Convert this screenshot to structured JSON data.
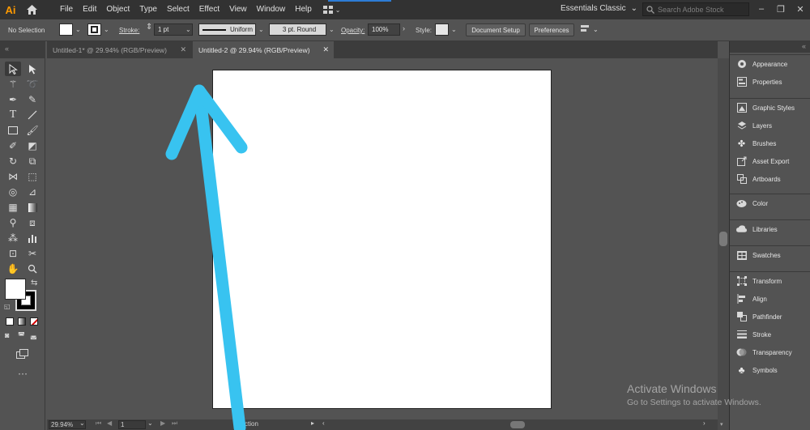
{
  "app": {
    "logo": "Ai",
    "accent": "#ff9a00"
  },
  "menu": [
    "File",
    "Edit",
    "Object",
    "Type",
    "Select",
    "Effect",
    "View",
    "Window",
    "Help"
  ],
  "workspace": {
    "label": "Essentials Classic"
  },
  "search": {
    "placeholder": "Search Adobe Stock"
  },
  "window_controls": {
    "minimize": "–",
    "maximize": "❐",
    "close": "✕"
  },
  "control": {
    "selection": "No Selection",
    "stroke_label": "Stroke:",
    "stroke_value": "1 pt",
    "profile": "Uniform",
    "brush": "3 pt. Round",
    "opacity_label": "Opacity:",
    "opacity_value": "100%",
    "style_label": "Style:",
    "doc_setup": "Document Setup",
    "preferences": "Preferences"
  },
  "tabs": [
    {
      "label": "Untitled-1* @ 29.94% (RGB/Preview)",
      "active": false
    },
    {
      "label": "Untitled-2 @ 29.94% (RGB/Preview)",
      "active": true
    }
  ],
  "status": {
    "zoom": "29.94%",
    "artboard": "1",
    "tool_hint": "ction"
  },
  "panels": [
    {
      "items": [
        {
          "label": "Appearance",
          "icon": "appearance-icon"
        },
        {
          "label": "Properties",
          "icon": "properties-icon"
        }
      ]
    },
    {
      "items": [
        {
          "label": "Graphic Styles",
          "icon": "graphic-styles-icon"
        },
        {
          "label": "Layers",
          "icon": "layers-icon"
        },
        {
          "label": "Brushes",
          "icon": "brushes-icon"
        },
        {
          "label": "Asset Export",
          "icon": "asset-export-icon"
        },
        {
          "label": "Artboards",
          "icon": "artboards-icon"
        }
      ]
    },
    {
      "items": [
        {
          "label": "Color",
          "icon": "color-icon"
        }
      ]
    },
    {
      "items": [
        {
          "label": "Libraries",
          "icon": "libraries-icon"
        }
      ]
    },
    {
      "items": [
        {
          "label": "Swatches",
          "icon": "swatches-icon"
        }
      ]
    },
    {
      "items": [
        {
          "label": "Transform",
          "icon": "transform-icon"
        },
        {
          "label": "Align",
          "icon": "align-icon"
        },
        {
          "label": "Pathfinder",
          "icon": "pathfinder-icon"
        },
        {
          "label": "Stroke",
          "icon": "stroke-icon"
        },
        {
          "label": "Transparency",
          "icon": "transparency-icon"
        },
        {
          "label": "Symbols",
          "icon": "symbols-icon"
        }
      ]
    }
  ],
  "watermark": {
    "title": "Activate Windows",
    "subtitle": "Go to Settings to activate Windows."
  },
  "annotation": {
    "arrow_color": "#38c3f0"
  }
}
